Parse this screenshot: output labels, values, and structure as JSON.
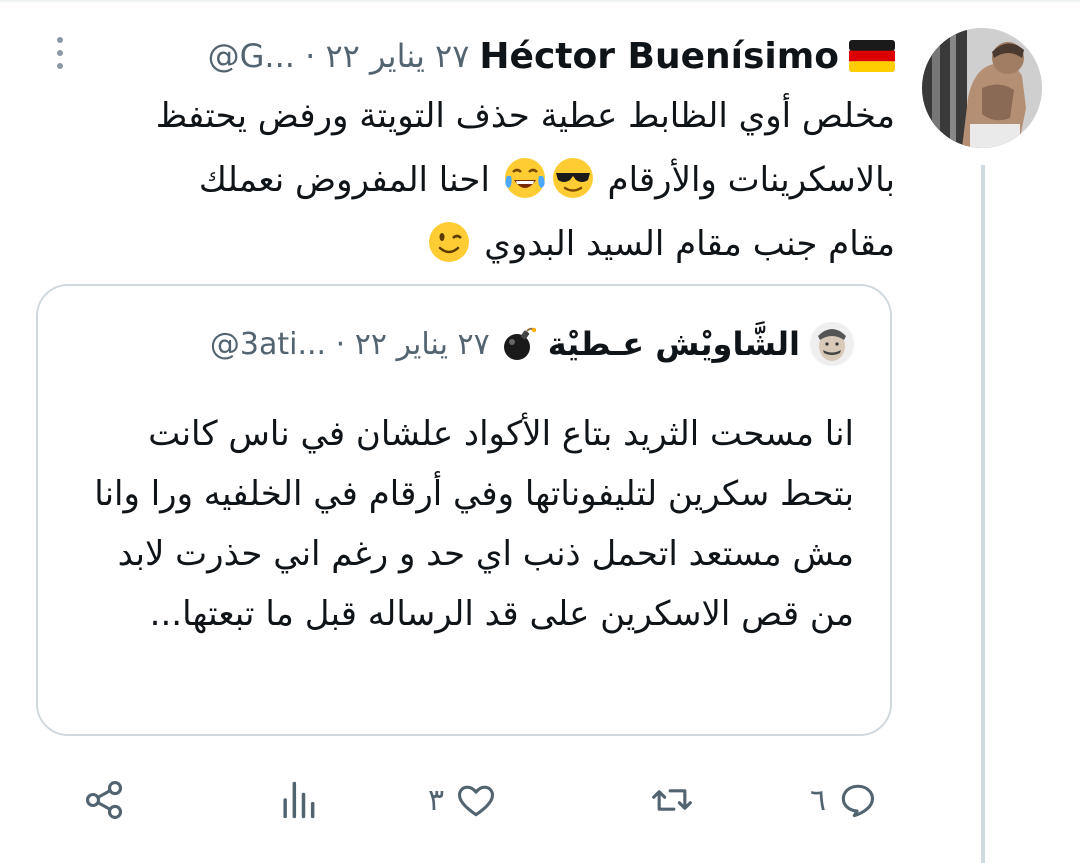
{
  "tweet": {
    "author_name": "Héctor Buenísimo",
    "handle": "@G...",
    "separator": "·",
    "date": "٢٧ يناير ٢٢",
    "text_line1": "مخلص أوي الظابط عطية حذف التويتة ورفض يحتفظ",
    "text_line2a": "بالاسكرينات والأرقام",
    "text_line2b": "احنا المفروض نعملك",
    "text_line3": "مقام جنب مقام السيد البدوي"
  },
  "quoted_tweet": {
    "author_name": "الشَّاويْش عـطيْة",
    "handle": "@3ati...",
    "separator": "·",
    "date": "٢٧ يناير ٢٢",
    "text": "انا مسحت الثريد بتاع الأكواد علشان في ناس كانت بتحط سكرين لتليفوناتها وفي أرقام في الخلفيه ورا وانا مش مستعد اتحمل ذنب اي حد و رغم اني حذرت لابد من قص الاسكرين على قد الرساله قبل ما تبعتها..."
  },
  "actions": {
    "reply_count": "٦",
    "retweet_count": "",
    "like_count": "٣",
    "views_label": "",
    "share_label": ""
  },
  "icons": {
    "more": "more-vertical-icon",
    "reply": "reply-icon",
    "retweet": "retweet-icon",
    "like": "heart-icon",
    "views": "views-icon",
    "share": "share-icon",
    "flag": "germany-flag-icon",
    "bomb": "bomb-icon"
  },
  "colors": {
    "text": "#0f1419",
    "secondary": "#536471",
    "border": "#cfd9de",
    "thread_line": "#cfd9de"
  }
}
